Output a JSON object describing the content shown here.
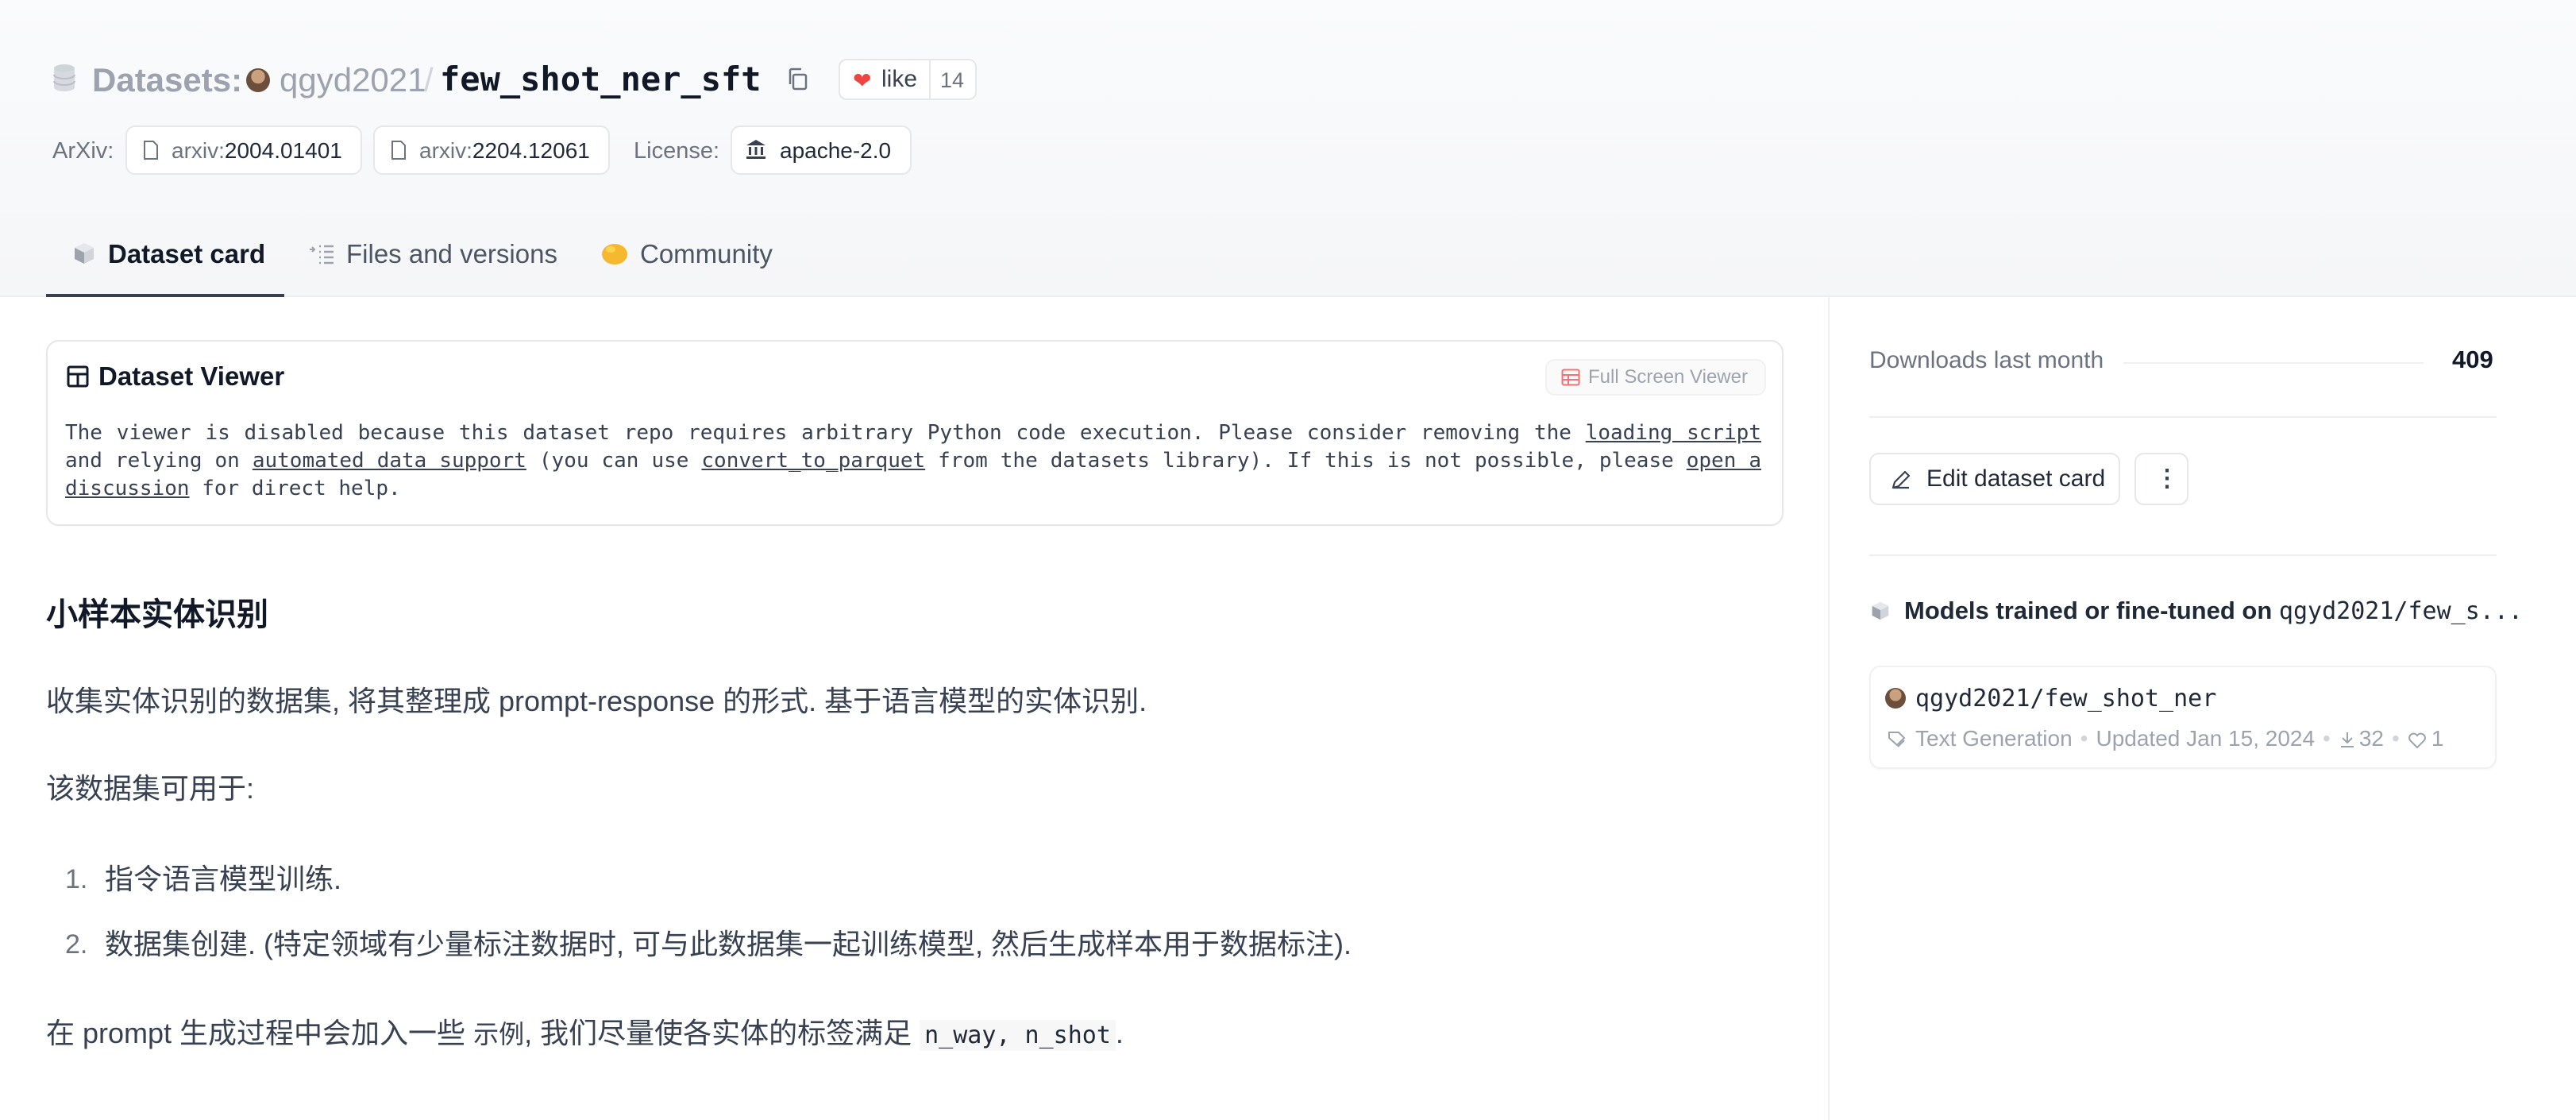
{
  "header": {
    "section_label": "Datasets:",
    "owner": "qgyd2021",
    "separator": "/",
    "repo_name": "few_shot_ner_sft",
    "like_label": "like",
    "like_count": "14",
    "arxiv_label": "ArXiv:",
    "arxiv_prefix": "arxiv:",
    "arxiv_ids": [
      "2004.01401",
      "2204.12061"
    ],
    "license_label": "License:",
    "license_value": "apache-2.0",
    "icons": [
      "database-icon",
      "avatar",
      "copy-icon",
      "heart-icon",
      "document-icon",
      "bank-icon"
    ]
  },
  "tabs": [
    {
      "label": "Dataset card",
      "active": true,
      "icon": "cube-icon"
    },
    {
      "label": "Files and versions",
      "active": false,
      "icon": "files-icon"
    },
    {
      "label": "Community",
      "active": false,
      "icon": "community-icon"
    }
  ],
  "viewer": {
    "title": "Dataset Viewer",
    "fullscreen_label": "Full Screen Viewer",
    "msg_1": "The viewer is disabled because this dataset repo requires arbitrary Python code execution. Please consider removing the ",
    "link_1": "loading script",
    "msg_2": " and relying on ",
    "link_2": "automated data support",
    "msg_3": " (you can use ",
    "link_3": "convert_to_parquet",
    "msg_4": " from the datasets library). If this is not possible, please ",
    "link_4": "open a discussion",
    "msg_5": " for direct help."
  },
  "content": {
    "heading": "小样本实体识别",
    "para1": "收集实体识别的数据集, 将其整理成 prompt-response 的形式. 基于语言模型的实体识别.",
    "para2": "该数据集可用于:",
    "list": [
      {
        "num": "1.",
        "text": "指令语言模型训练."
      },
      {
        "num": "2.",
        "text": "数据集创建. (特定领域有少量标注数据时, 可与此数据集一起训练模型, 然后生成样本用于数据标注)."
      }
    ],
    "para3_a": "在 prompt 生成过程中会加入一些 ",
    "para3_b": "示例",
    "para3_c": ", 我们尽量使各实体的标签满足 ",
    "para3_code": "n_way, n_shot",
    "para3_d": "."
  },
  "sidebar": {
    "downloads_label": "Downloads last month",
    "downloads_value": "409",
    "edit_label": "Edit dataset card",
    "more_label": "⋮",
    "models_title": "Models trained or fine-tuned on",
    "models_repo": "qgyd2021/few_s...",
    "model": {
      "name": "qgyd2021/few_shot_ner",
      "task": "Text Generation",
      "updated": "Updated Jan 15, 2024",
      "downloads": "32",
      "likes": "1"
    }
  },
  "colors": {
    "heart": "#ef4444",
    "community_icon": "#f5b82e",
    "fullscreen_icon": "#f87171",
    "active_tab_underline": "#374151"
  }
}
